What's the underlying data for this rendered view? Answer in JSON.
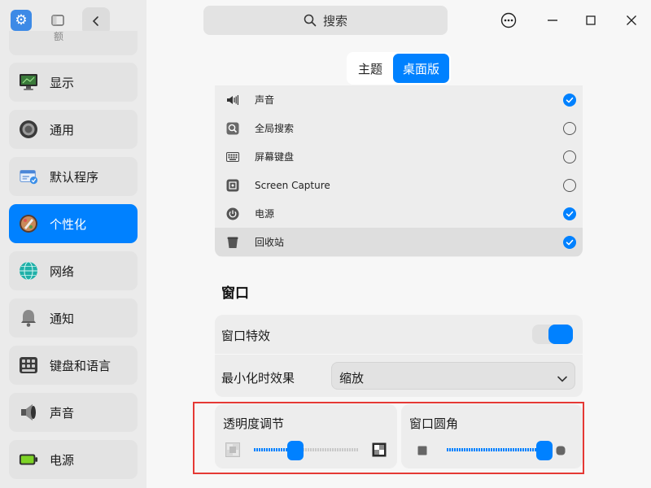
{
  "sidebar": {
    "partial_item_label": "额",
    "items": [
      {
        "label": "显示",
        "icon": "monitor-icon",
        "active": false
      },
      {
        "label": "通用",
        "icon": "general-icon",
        "active": false
      },
      {
        "label": "默认程序",
        "icon": "default-apps-icon",
        "active": false
      },
      {
        "label": "个性化",
        "icon": "personalization-icon",
        "active": true
      },
      {
        "label": "网络",
        "icon": "network-icon",
        "active": false
      },
      {
        "label": "通知",
        "icon": "bell-icon",
        "active": false
      },
      {
        "label": "键盘和语言",
        "icon": "keyboard-icon",
        "active": false
      },
      {
        "label": "声音",
        "icon": "speaker-icon",
        "active": false
      },
      {
        "label": "电源",
        "icon": "battery-icon",
        "active": false
      }
    ]
  },
  "header": {
    "search_label": "搜索"
  },
  "tabs": [
    {
      "label": "主题",
      "active": false
    },
    {
      "label": "桌面版",
      "active": true
    }
  ],
  "plugins": [
    {
      "label": "声音",
      "icon": "volume-icon",
      "checked": true
    },
    {
      "label": "全局搜索",
      "icon": "search-icon",
      "checked": false
    },
    {
      "label": "屏幕键盘",
      "icon": "keyboard-icon",
      "checked": false
    },
    {
      "label": "Screen Capture",
      "icon": "screen-capture-icon",
      "checked": false
    },
    {
      "label": "电源",
      "icon": "power-icon",
      "checked": true
    },
    {
      "label": "回收站",
      "icon": "trash-icon",
      "checked": true
    }
  ],
  "window_section": {
    "title": "窗口",
    "effects_label": "窗口特效",
    "effects_enabled": true,
    "minimize_label": "最小化时效果",
    "minimize_value": "缩放",
    "opacity": {
      "label": "透明度调节",
      "value": 0.4
    },
    "corner_radius": {
      "label": "窗口圆角",
      "value": 1.0
    }
  },
  "colors": {
    "accent": "#0081ff",
    "highlight_border": "#e53935"
  }
}
